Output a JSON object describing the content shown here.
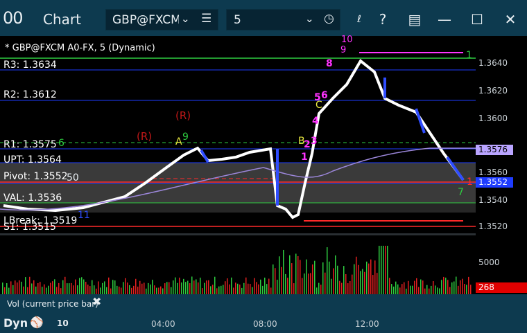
{
  "window": {
    "icon": "00",
    "title": "Chart",
    "symbol": "GBP@FXCM",
    "interval": "5"
  },
  "chart_header": "* GBP@FXCM A0-FX, 5 (Dynamic)",
  "levels": {
    "r3": "R3: 1.3634",
    "r2": "R2: 1.3612",
    "r1": "R1: 1.3575",
    "upt": "UPT: 1.3564",
    "pivot": "Pivot: 1.3552",
    "val": "VAL: 1.3536",
    "lbreak": "LBreak: 1.3519",
    "s1": "S1: 1.3515"
  },
  "annotations": {
    "r_a": "(R)",
    "r_b": "(R)",
    "a": "A",
    "b": "B",
    "c": "C",
    "nine_a": "9",
    "nine_b": "9",
    "ten": "10",
    "one_a": "1",
    "one_b": "1",
    "two": "2",
    "three": "3",
    "four": "4",
    "five": "5",
    "six": "6",
    "six_b": "6",
    "seven": "7",
    "eight": "8",
    "fifty": "50",
    "eleven": "11",
    "one_red": "1"
  },
  "price_axis": {
    "ticks": [
      "1.3640",
      "1.3620",
      "1.3600",
      "1.3580",
      "1.3560",
      "1.3540",
      "1.3520"
    ],
    "last_price": "1.3576",
    "current_price": "1.3552"
  },
  "volume_axis": {
    "tick": "5000",
    "current_volume": "268"
  },
  "volume_legend": "Vol (current price bar)",
  "bottom": {
    "dyn": "Dyn",
    "day": "10",
    "times": [
      "04:00",
      "08:00",
      "12:00"
    ]
  },
  "colors": {
    "titlebar": "#0d3a4f",
    "up_bar": "#ffffff",
    "down_bar": "#2f4dff",
    "pivot_line": "#ff2a2a",
    "level_line": "#1e3cff",
    "accent_magenta": "#ff33ff",
    "volume_up": "#2ecc40",
    "volume_down": "#e32020"
  }
}
